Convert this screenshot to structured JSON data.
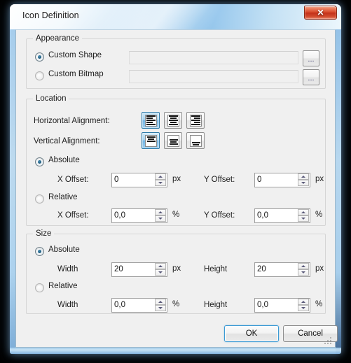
{
  "window": {
    "title": "Icon Definition",
    "close_label": "✕",
    "accent_color": "#74b6e4",
    "close_color": "#d64526"
  },
  "appearance": {
    "group_title": "Appearance",
    "options": [
      {
        "label": "Custom Shape",
        "selected": true,
        "value": "",
        "browse_label": "..."
      },
      {
        "label": "Custom Bitmap",
        "selected": false,
        "value": "",
        "browse_label": "..."
      }
    ]
  },
  "location": {
    "group_title": "Location",
    "horizontal_alignment_label": "Horizontal Alignment:",
    "vertical_alignment_label": "Vertical Alignment:",
    "horizontal_buttons": [
      "align-left-icon",
      "align-center-icon",
      "align-right-icon"
    ],
    "horizontal_selected_index": 0,
    "vertical_buttons": [
      "align-top-icon",
      "align-middle-icon",
      "align-bottom-icon"
    ],
    "vertical_selected_index": 0,
    "absolute": {
      "label": "Absolute",
      "selected": true,
      "x_label": "X Offset:",
      "x_value": "0",
      "x_unit": "px",
      "y_label": "Y Offset:",
      "y_value": "0",
      "y_unit": "px"
    },
    "relative": {
      "label": "Relative",
      "selected": false,
      "x_label": "X Offset:",
      "x_value": "0,0",
      "x_unit": "%",
      "y_label": "Y Offset:",
      "y_value": "0,0",
      "y_unit": "%"
    }
  },
  "size": {
    "group_title": "Size",
    "absolute": {
      "label": "Absolute",
      "selected": true,
      "width_label": "Width",
      "width_value": "20",
      "width_unit": "px",
      "height_label": "Height",
      "height_value": "20",
      "height_unit": "px"
    },
    "relative": {
      "label": "Relative",
      "selected": false,
      "width_label": "Width",
      "width_value": "0,0",
      "width_unit": "%",
      "height_label": "Height",
      "height_value": "0,0",
      "height_unit": "%"
    }
  },
  "footer": {
    "ok_label": "OK",
    "cancel_label": "Cancel"
  }
}
